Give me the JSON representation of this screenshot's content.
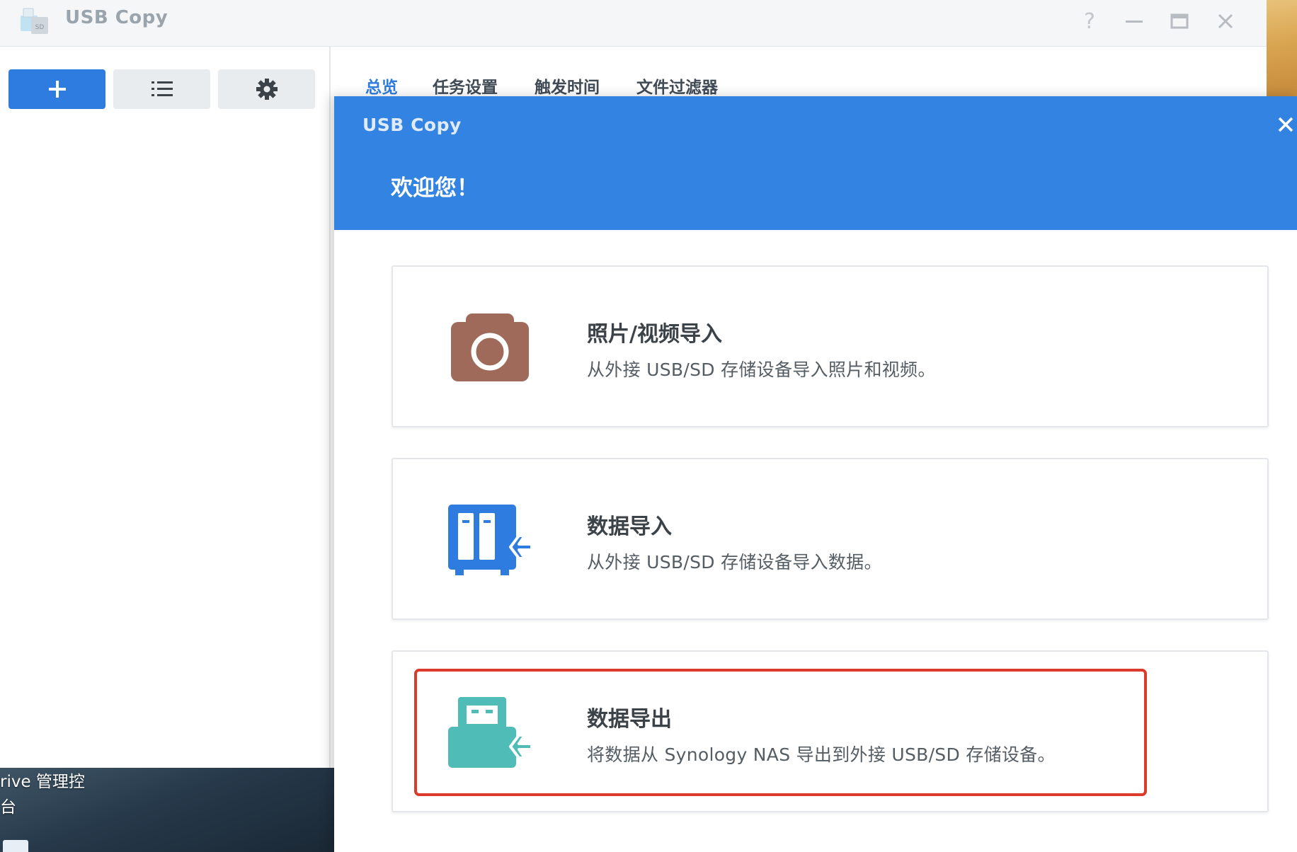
{
  "window": {
    "title": "USB Copy",
    "controls": [
      "?",
      "minimize",
      "maximize",
      "close"
    ]
  },
  "toolbar": {
    "buttons": [
      {
        "name": "add",
        "icon": "plus-icon"
      },
      {
        "name": "list",
        "icon": "list-icon"
      },
      {
        "name": "settings",
        "icon": "gear-icon"
      }
    ]
  },
  "tabs": [
    {
      "label": "总览",
      "active": true
    },
    {
      "label": "任务设置",
      "active": false
    },
    {
      "label": "触发时间",
      "active": false
    },
    {
      "label": "文件过滤器",
      "active": false
    }
  ],
  "desktop": {
    "label_line1": "rive 管理控",
    "label_line2": "台"
  },
  "dialog": {
    "title": "USB Copy",
    "welcome": "欢迎您！",
    "options": [
      {
        "title": "照片/视频导入",
        "description": "从外接 USB/SD 存储设备导入照片和视频。",
        "icon": "camera-icon",
        "color": "#a06a5a"
      },
      {
        "title": "数据导入",
        "description": "从外接 USB/SD 存储设备导入数据。",
        "icon": "nas-import-icon",
        "color": "#2f7ce0"
      },
      {
        "title": "数据导出",
        "description": "将数据从 Synology NAS 导出到外接 USB/SD 存储设备。",
        "icon": "usb-export-icon",
        "color": "#4fbcb8",
        "highlighted": true
      }
    ]
  },
  "colors": {
    "accent": "#2f7ce0",
    "header": "#3383e2",
    "highlight": "#dc3b2b"
  }
}
